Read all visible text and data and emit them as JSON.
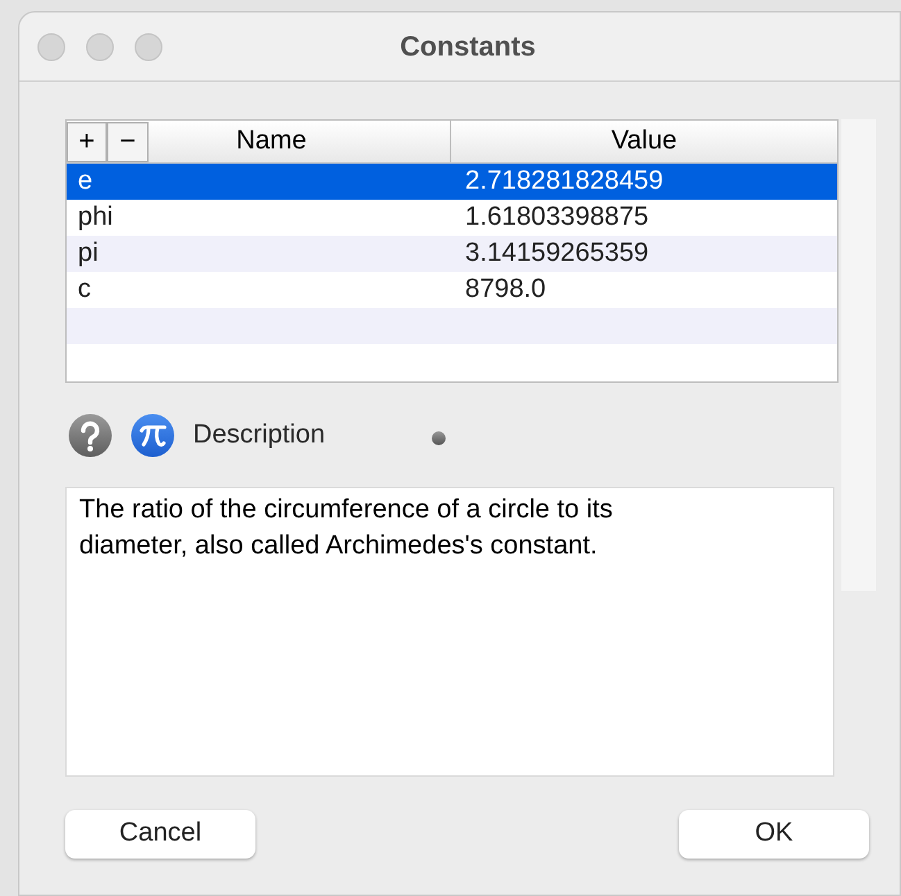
{
  "window": {
    "title": "Constants"
  },
  "table": {
    "add_button": "+",
    "remove_button": "−",
    "columns": [
      "Name",
      "Value"
    ],
    "rows": [
      {
        "name": "e",
        "value": "2.718281828459",
        "selected": true
      },
      {
        "name": "phi",
        "value": "1.61803398875",
        "selected": false
      },
      {
        "name": "pi",
        "value": "3.14159265359",
        "selected": false
      },
      {
        "name": "c",
        "value": "8798.0",
        "selected": false
      }
    ]
  },
  "description": {
    "label": "Description",
    "text": "The ratio of the circumference of a circle to its diameter, also called Archimedes's constant."
  },
  "buttons": {
    "cancel": "Cancel",
    "ok": "OK"
  }
}
